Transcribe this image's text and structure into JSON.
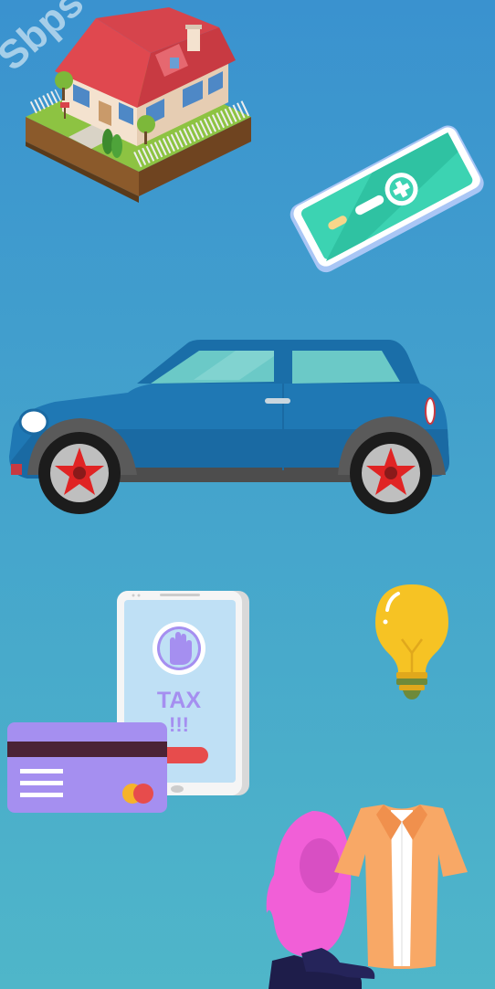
{
  "background": {
    "top": "#3a92cf",
    "bottom": "#4fb6c9"
  },
  "watermark": "Sbps",
  "phone_screen": {
    "title": "TAX",
    "exclaim": "!!!",
    "icon": "hand-stop-icon"
  },
  "colors": {
    "car_body": "#1f78b4",
    "car_window": "#6bc9c7",
    "bulb": "#f6c324",
    "card": "#a58ff0",
    "card_stripe": "#4b2336",
    "shirt": "#f8a866",
    "hijab": "#f15fd7",
    "health_phone": "#3cd3b2",
    "tax_accent": "#a58ff0",
    "tax_bar": "#e74c4c"
  },
  "icons": [
    "house-icon",
    "health-phone-icon",
    "car-icon",
    "tax-phone-icon",
    "lightbulb-icon",
    "credit-card-icon",
    "hijab-icon",
    "shirt-icon",
    "shoes-icon"
  ]
}
